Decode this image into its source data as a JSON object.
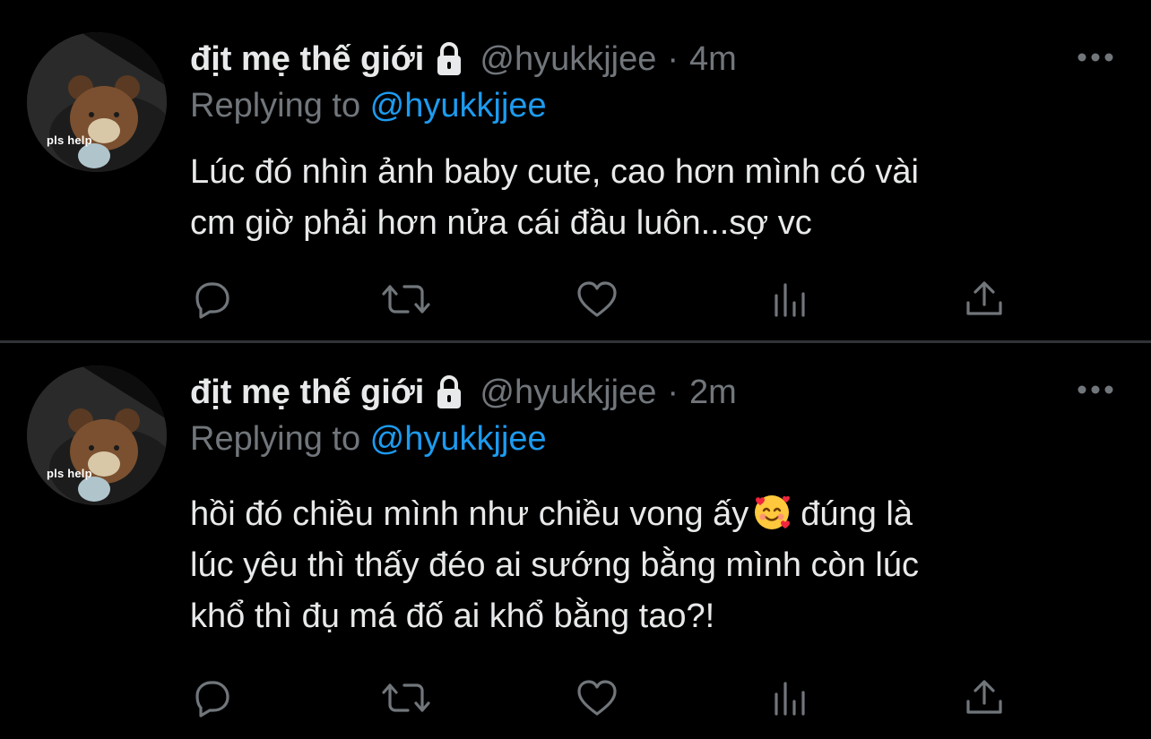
{
  "tweets": [
    {
      "avatar_caption": "pls help",
      "display_name": "địt mẹ thế giới",
      "handle": "@hyukkjjee",
      "separator": "·",
      "time": "4m",
      "replying_prefix": "Replying to ",
      "replying_handle": "@hyukkjjee",
      "body_lines": [
        "Lúc đó nhìn ảnh baby cute, cao hơn mình có vài",
        "cm giờ phải hơn nửa cái đầu luôn...sợ vc"
      ]
    },
    {
      "avatar_caption": "pls help",
      "display_name": "địt mẹ thế giới",
      "handle": "@hyukkjjee",
      "separator": "·",
      "time": "2m",
      "replying_prefix": "Replying to ",
      "replying_handle": "@hyukkjjee",
      "body_line1_before_emoji": "hồi đó chiều mình như chiều vong ấy",
      "body_line1_after_emoji": "đúng là",
      "body_lines_rest": [
        "lúc yêu thì thấy đéo ai sướng bằng mình còn lúc",
        "khổ thì đụ má đố ai khổ bằng tao?!"
      ]
    }
  ],
  "icons": {
    "lock": "lock-icon",
    "more": "more-icon",
    "reply": "reply-icon",
    "retweet": "retweet-icon",
    "like": "heart-icon",
    "analytics": "analytics-icon",
    "share": "share-icon",
    "emoji": "smiling-face-with-hearts"
  },
  "colors": {
    "background": "#000000",
    "text_primary": "#e7e9ea",
    "text_secondary": "#71767b",
    "link": "#1d9bf0",
    "divider": "#2f3336"
  }
}
